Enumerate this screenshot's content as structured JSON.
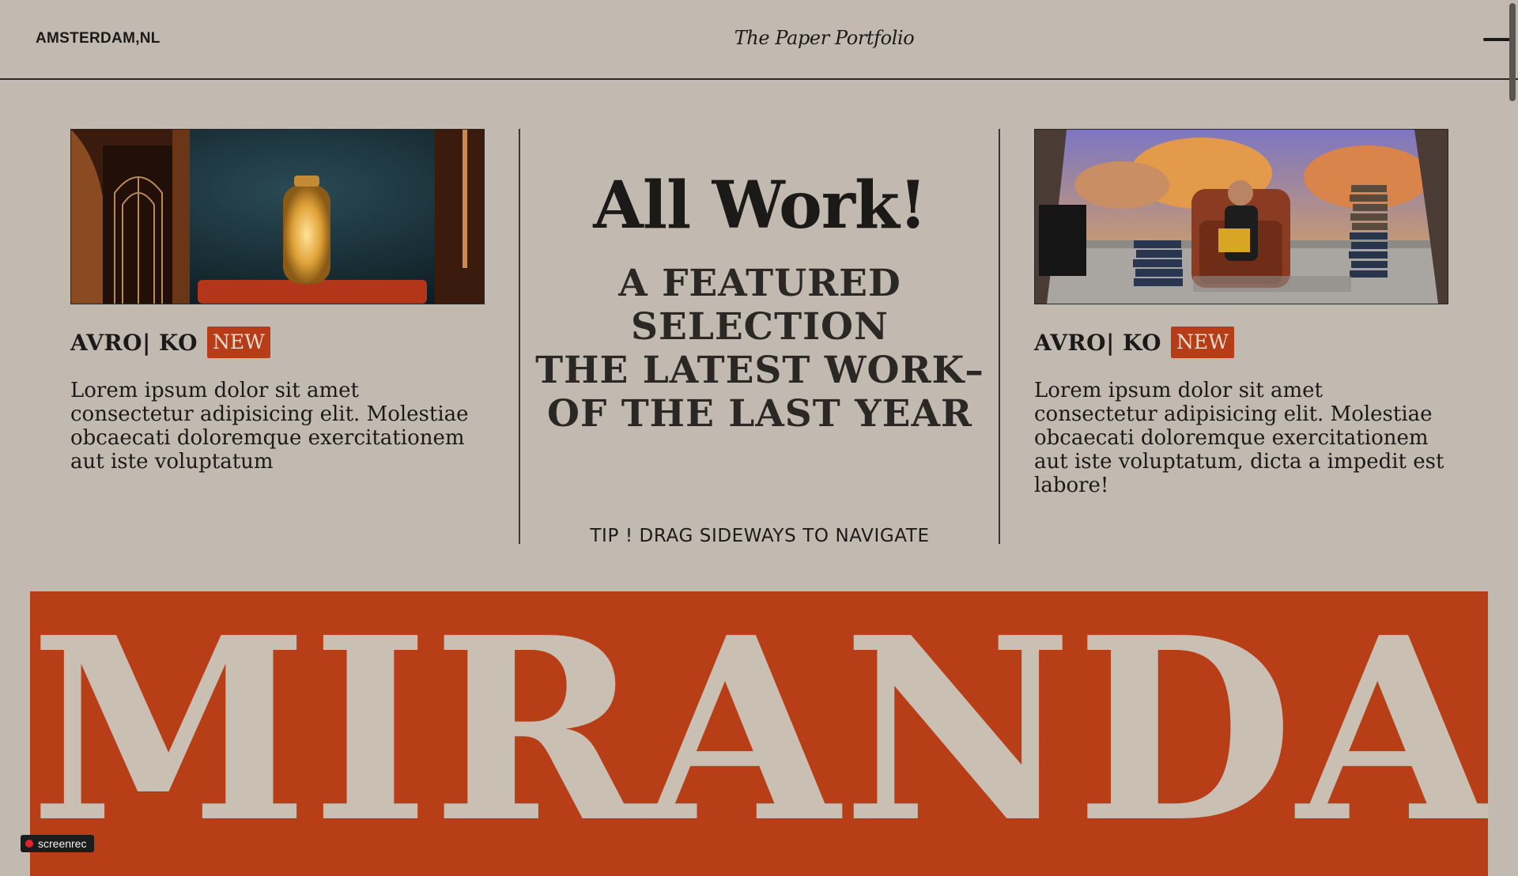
{
  "header": {
    "location": "AMSTERDAM,NL",
    "brand": "The Paper Portfolio",
    "menu_icon": "hamburger-icon"
  },
  "cards": [
    {
      "title": "AVRO| KO",
      "badge": "NEW",
      "description": "Lorem ipsum dolor sit amet consectetur adipisicing elit. Molestiae obcaecati doloremque exercitationem aut iste voluptatum",
      "image": "lantern-on-red-sofa-image"
    },
    {
      "title": "AVRO| KO",
      "badge": "NEW",
      "description": "Lorem ipsum dolor sit amet consectetur adipisicing elit. Molestiae obcaecati doloremque exercitationem aut iste voluptatum, dicta a impedit est labore!",
      "image": "man-reading-armchair-image"
    }
  ],
  "center": {
    "title": "All Work!",
    "subtitle_lines": [
      "A FEATURED",
      "SELECTION",
      "THE LATEST WORK–",
      "OF THE LAST YEAR"
    ],
    "tip": "TIP ! DRAG SIDEWAYS TO NAVIGATE"
  },
  "banner": {
    "text": "MIRANDA"
  },
  "watermark": {
    "label": "screenrec"
  },
  "colors": {
    "background": "#c2bab0",
    "accent": "#b83e17",
    "text": "#1b1a18"
  }
}
